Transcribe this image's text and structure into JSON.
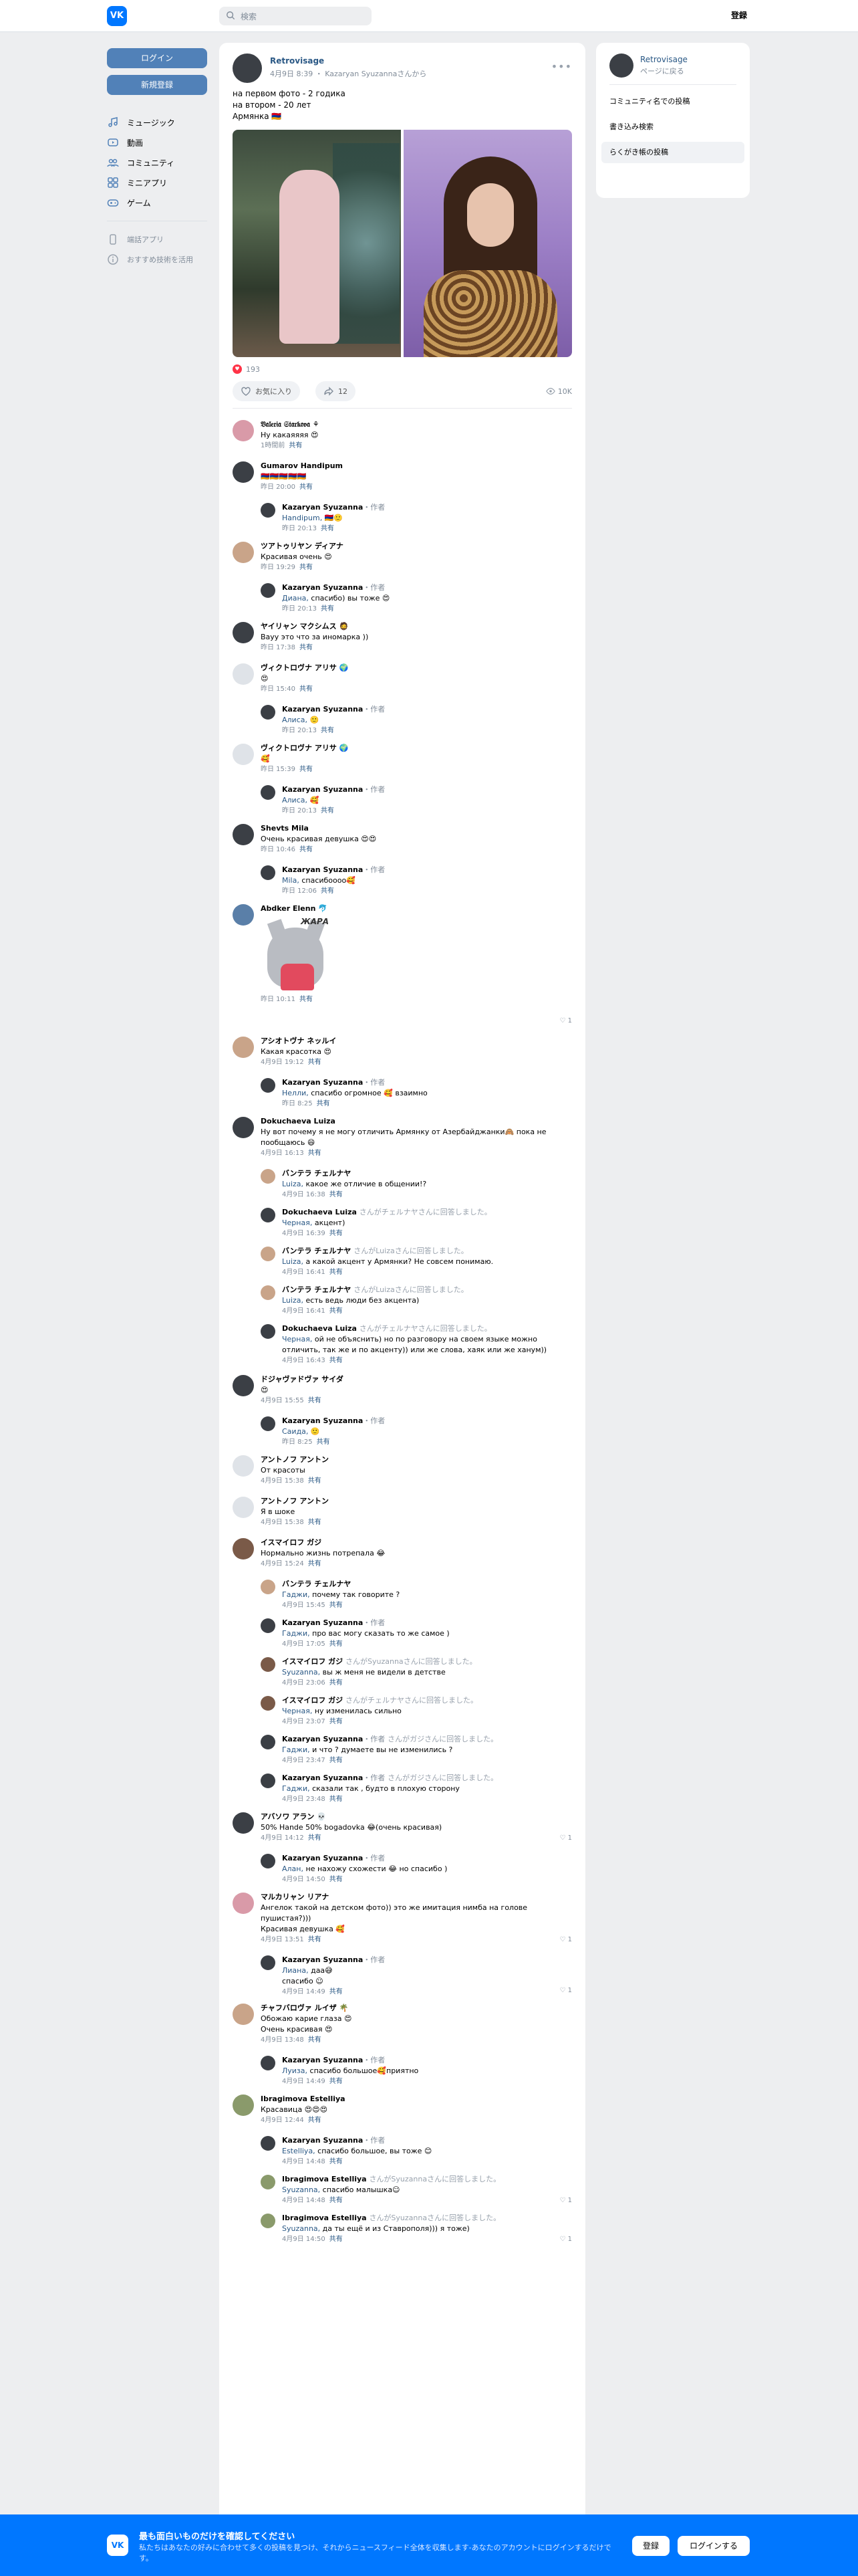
{
  "topbar": {
    "logo": "VK",
    "search_placeholder": "検索",
    "login": "登録"
  },
  "leftnav": {
    "login_button": "ログイン",
    "register_button": "新規登録",
    "items": [
      {
        "label": "ミュージック",
        "icon": "music-icon"
      },
      {
        "label": "動画",
        "icon": "video-icon"
      },
      {
        "label": "コミュニティ",
        "icon": "community-icon"
      },
      {
        "label": "ミニアプリ",
        "icon": "miniapps-icon"
      },
      {
        "label": "ゲーム",
        "icon": "games-icon"
      }
    ],
    "mobile_app": "端話アプリ",
    "recommend": "おすすめ技術を活用"
  },
  "post": {
    "author": "Retrovisage",
    "meta": "4月9日 8:39 ・ Kazaryan Syuzannaさんから",
    "text_lines": [
      "на первом фото - 2 годика",
      "на втором - 20 лет",
      "Армянка 🇦🇲"
    ],
    "reactions_count": "193",
    "like_label": "お気に入り",
    "share_count": "12",
    "views": "10K"
  },
  "comments": [
    {
      "id": "c1",
      "name": "𝔙𝔞𝔩𝔢𝔯𝔦𝔞 𝔖𝔱𝔞𝔯𝔨𝔬𝔳𝔞 ⚘",
      "text": "Ну какаяяяя 😍",
      "meta": "1時間前",
      "ava": "ava-pink"
    },
    {
      "id": "c2",
      "name": "Gumarov Handipum",
      "text": "🇦🇲🇦🇲🇦🇲🇦🇲🇦🇲",
      "meta": "昨日 20:00",
      "ava": "ava-dark"
    },
    {
      "id": "r2",
      "reply": true,
      "name": "Kazaryan Syuzanna",
      "tag": "・作者",
      "mention": "Handipum,",
      "text": " 🇦🇲🙂",
      "meta": "昨日 20:13",
      "ava": "ava-dark"
    },
    {
      "id": "c3",
      "name": "ツアトゥリヤン ディアナ",
      "text": "Красивая очень 😍",
      "meta": "昨日 19:29",
      "ava": "ava-warm"
    },
    {
      "id": "r3",
      "reply": true,
      "name": "Kazaryan Syuzanna",
      "tag": "・作者",
      "mention": "Диана,",
      "text": " спасибо) вы тоже 😍",
      "meta": "昨日 20:13",
      "ava": "ava-dark"
    },
    {
      "id": "c4",
      "name": "ヤイリャン マクシムス 🧔",
      "text": "Вауу это что за иномарка ))",
      "meta": "昨日 17:38",
      "ava": "ava-dark"
    },
    {
      "id": "c5",
      "name": "ヴィクトロヴナ アリサ 🌍",
      "text": "😍",
      "meta": "昨日 15:40",
      "ava": "ava-grey"
    },
    {
      "id": "r5",
      "reply": true,
      "name": "Kazaryan Syuzanna",
      "tag": "・作者",
      "mention": "Алиса,",
      "text": " 🙂",
      "meta": "昨日 20:13",
      "ava": "ava-dark"
    },
    {
      "id": "c6",
      "name": "ヴィクトロヴナ アリサ 🌍",
      "text": "🥰",
      "meta": "昨日 15:39",
      "ava": "ava-grey"
    },
    {
      "id": "r6",
      "reply": true,
      "name": "Kazaryan Syuzanna",
      "tag": "・作者",
      "mention": "Алиса,",
      "text": " 🥰",
      "meta": "昨日 20:13",
      "ava": "ava-dark"
    },
    {
      "id": "c7",
      "name": "Shevts Mila",
      "text": "Очень красивая девушка 😍😍",
      "meta": "昨日 10:46",
      "ava": "ava-dark"
    },
    {
      "id": "r7",
      "reply": true,
      "name": "Kazaryan Syuzanna",
      "tag": "・作者",
      "mention": "Mila,",
      "text": " спасибоооо🥰",
      "meta": "昨日 12:06",
      "ava": "ava-dark"
    },
    {
      "id": "c8",
      "name": "Abdker Elenn 🐬",
      "sticker": "ЖАРА",
      "meta": "昨日 10:11",
      "likes": "1",
      "ava": "ava-blue"
    },
    {
      "id": "c9",
      "name": "アシオトヴナ ネッルイ",
      "text": "Какая красотка 😍",
      "meta": "4月9日 19:12",
      "ava": "ava-warm"
    },
    {
      "id": "r9",
      "reply": true,
      "name": "Kazaryan Syuzanna",
      "tag": "・作者",
      "mention": "Нелли,",
      "text": " спасибо огромное 🥰 взаимно",
      "meta": "昨日 8:25",
      "ava": "ava-dark"
    },
    {
      "id": "c10",
      "name": "Dokuchaeva Luiza",
      "text": "Ну вот почему я не могу отличить Армянку от Азербайджанки🙈 пока не пообщаюсь 😄",
      "meta": "4月9日 16:13",
      "ava": "ava-dark"
    },
    {
      "id": "r10a",
      "reply": true,
      "name": "バンテラ チェルナヤ",
      "text": "Luiza, какое же отличие в общении!?",
      "mention_first": "Luiza,",
      "rest": " какое же отличие в общении!?",
      "meta": "4月9日 16:38",
      "ava": "ava-warm"
    },
    {
      "id": "r10b",
      "reply": true,
      "name": "Dokuchaeva Luiza",
      "replyto": "さんがチェルナヤさんに回答しました。",
      "mention": "Черная,",
      "text": " акцент)",
      "meta": "4月9日 16:39",
      "ava": "ava-dark"
    },
    {
      "id": "r10c",
      "reply": true,
      "name": "バンテラ チェルナヤ",
      "replyto": "さんがLuizaさんに回答しました。",
      "mention": "Luiza,",
      "text": " а какой акцент у Армянки? Не совсем понимаю.",
      "meta": "4月9日 16:41",
      "ava": "ava-warm"
    },
    {
      "id": "r10d",
      "reply": true,
      "name": "バンテラ チェルナヤ",
      "replyto": "さんがLuizaさんに回答しました。",
      "mention": "Luiza,",
      "text": " есть ведь люди без акцента)",
      "meta": "4月9日 16:41",
      "ava": "ava-warm"
    },
    {
      "id": "r10e",
      "reply": true,
      "name": "Dokuchaeva Luiza",
      "replyto": "さんがチェルナヤさんに回答しました。",
      "mention": "Черная,",
      "text": " ой не объяснить) но по разговору на своем языке можно отличить, так же и по акценту)) или же слова, хаяк или же ханум))",
      "meta": "4月9日 16:43",
      "ava": "ava-dark"
    },
    {
      "id": "c11",
      "name": "ドジャヴァドヴァ サイダ",
      "text": "😍",
      "meta": "4月9日 15:55",
      "ava": "ava-dark"
    },
    {
      "id": "r11",
      "reply": true,
      "name": "Kazaryan Syuzanna",
      "tag": "・作者",
      "mention": "Саида,",
      "text": " 🙂",
      "meta": "昨日 8:25",
      "ava": "ava-dark"
    },
    {
      "id": "c12",
      "name": "アントノフ アントン",
      "text": "От красоты",
      "meta": "4月9日 15:38",
      "ava": "ava-grey"
    },
    {
      "id": "c13",
      "name": "アントノフ アントン",
      "text": "Я в шоке",
      "meta": "4月9日 15:38",
      "ava": "ava-grey"
    },
    {
      "id": "c14",
      "name": "イスマイロフ ガジ",
      "text": "Нормально жизнь потрепала 😂",
      "meta": "4月9日 15:24",
      "ava": "ava-brown"
    },
    {
      "id": "r14a",
      "reply": true,
      "name": "バンテラ チェルナヤ",
      "mention": "Гаджи,",
      "text": " почему так говорите ?",
      "meta": "4月9日 15:45",
      "ava": "ava-warm"
    },
    {
      "id": "r14b",
      "reply": true,
      "name": "Kazaryan Syuzanna",
      "tag": "・作者",
      "mention": "Гаджи,",
      "text": " про вас могу сказать то же самое )",
      "meta": "4月9日 17:05",
      "ava": "ava-dark"
    },
    {
      "id": "r14c",
      "reply": true,
      "name": "イスマイロフ ガジ",
      "replyto": "さんがSyuzannaさんに回答しました。",
      "mention": "Syuzanna,",
      "text": " вы ж меня не видели в детстве",
      "meta": "4月9日 23:06",
      "ava": "ava-brown"
    },
    {
      "id": "r14d",
      "reply": true,
      "name": "イスマイロフ ガジ",
      "replyto": "さんがチェルナヤさんに回答しました。",
      "mention": "Черная,",
      "text": " ну изменилась сильно",
      "meta": "4月9日 23:07",
      "ava": "ava-brown"
    },
    {
      "id": "r14e",
      "reply": true,
      "name": "Kazaryan Syuzanna",
      "tag": "・作者",
      "replyto": "さんがガジさんに回答しました。",
      "mention": "Гаджи,",
      "text": " и что ? думаете вы не изменились ?",
      "meta": "4月9日 23:47",
      "ava": "ava-dark"
    },
    {
      "id": "r14f",
      "reply": true,
      "name": "Kazaryan Syuzanna",
      "tag": "・作者",
      "replyto": "さんがガジさんに回答しました。",
      "mention": "Гаджи,",
      "text": " сказали так , будто в плохую сторону",
      "meta": "4月9日 23:48",
      "ava": "ava-dark"
    },
    {
      "id": "c15",
      "name": "アバソワ アラン 💀",
      "text": "50% Hande 50% bogadovka 😂(очень красивая)",
      "meta": "4月9日 14:12",
      "likes": "1",
      "ava": "ava-dark"
    },
    {
      "id": "r15",
      "reply": true,
      "name": "Kazaryan Syuzanna",
      "tag": "・作者",
      "mention": "Алан,",
      "text": " не нахожу схожести 😂 но спасибо )",
      "meta": "4月9日 14:50",
      "ava": "ava-dark"
    },
    {
      "id": "c16",
      "name": "マルカリャン リアナ",
      "text": "Ангелок такой на детском фото)) это же имитация нимба на голове пушистая?)))\nКрасивая девушка 🥰",
      "meta": "4月9日 13:51",
      "likes": "1",
      "ava": "ava-pink"
    },
    {
      "id": "r16",
      "reply": true,
      "name": "Kazaryan Syuzanna",
      "tag": "・作者",
      "mention": "Лиана,",
      "text": " даа😅\nспасибо ☺",
      "meta": "4月9日 14:49",
      "likes": "1",
      "ava": "ava-dark"
    },
    {
      "id": "c17",
      "name": "チャフバロヴァ ルイザ 🌴",
      "text": "Обожаю карие глаза 😍\nОчень красивая 😍",
      "meta": "4月9日 13:48",
      "ava": "ava-warm"
    },
    {
      "id": "r17",
      "reply": true,
      "name": "Kazaryan Syuzanna",
      "tag": "・作者",
      "mention": "Луиза,",
      "text": " спасибо большое🥰приятно",
      "meta": "4月9日 14:49",
      "ava": "ava-dark"
    },
    {
      "id": "c18",
      "name": "Ibragimova Estelliya",
      "text": "Красавица 😍😍😍",
      "meta": "4月9日 12:44",
      "ava": "ava-green"
    },
    {
      "id": "r18a",
      "reply": true,
      "name": "Kazaryan Syuzanna",
      "tag": "・作者",
      "mention": "Estelliya,",
      "text": " спасибо большое, вы тоже 😊",
      "meta": "4月9日 14:48",
      "ava": "ava-dark"
    },
    {
      "id": "r18b",
      "reply": true,
      "name": "Ibragimova Estelliya",
      "replyto": "さんがSyuzannaさんに回答しました。",
      "mention": "Syuzanna,",
      "text": " спасибо малышка☺",
      "meta": "4月9日 14:48",
      "likes": "1",
      "ava": "ava-green"
    },
    {
      "id": "r18c",
      "reply": true,
      "name": "Ibragimova Estelliya",
      "replyto": "さんがSyuzannaさんに回答しました。",
      "mention": "Syuzanna,",
      "text": " да ты ещё и из Ставрополя))) я тоже)",
      "meta": "4月9日 14:50",
      "likes": "1",
      "ava": "ava-green"
    }
  ],
  "share_label": "共有",
  "rightcol": {
    "name": "Retrovisage",
    "back": "ページに戻る",
    "items": [
      "コミュニティ名での投稿",
      "書き込み検索",
      "らくがき帳の投稿"
    ]
  },
  "banner": {
    "logo": "VK",
    "title": "最も面白いものだけを確認してください",
    "subtitle": "私たちはあなたの好みに合わせて多くの投稿を見つけ、それからニュースフィード全体を収集します-あなたのアカウントにログインするだけです。",
    "signup": "登録",
    "login": "ログインする"
  },
  "colors": {
    "accent": "#0077ff",
    "link": "#2a5885",
    "button": "#5181b8",
    "background": "#edeef0"
  }
}
